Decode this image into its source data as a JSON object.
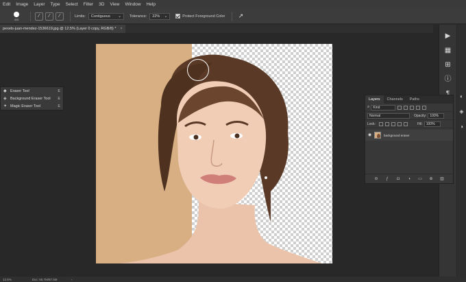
{
  "menu": {
    "items": [
      "Edit",
      "Image",
      "Layer",
      "Type",
      "Select",
      "Filter",
      "3D",
      "View",
      "Window",
      "Help"
    ]
  },
  "options": {
    "brush_size": "400",
    "limits_label": "Limits:",
    "limits_value": "Contiguous",
    "tolerance_label": "Tolerance:",
    "tolerance_value": "22%",
    "protect_label": "Protect Foreground Color"
  },
  "document": {
    "tab_title": "pexels-juan-mendez-1536619.jpg @ 12.5% (Layer 0 copy, RGB/8) *",
    "tab_close": "×"
  },
  "tool_flyout": {
    "items": [
      {
        "label": "Eraser Tool",
        "shortcut": "E",
        "icon": "eraser-icon"
      },
      {
        "label": "Background Eraser Tool",
        "shortcut": "E",
        "icon": "background-eraser-icon"
      },
      {
        "label": "Magic Eraser Tool",
        "shortcut": "E",
        "icon": "magic-eraser-icon"
      }
    ]
  },
  "layers_panel": {
    "tabs": [
      "Layers",
      "Channels",
      "Paths"
    ],
    "kind_label": "Kind",
    "blend_mode": "Normal",
    "opacity_label": "Opacity:",
    "opacity_value": "100%",
    "lock_label": "Lock:",
    "fill_label": "Fill:",
    "fill_value": "100%",
    "layer_name": "background eraser"
  },
  "status": {
    "zoom": "12.5%",
    "doc_info": "Doc: 65.7M/87.5M"
  },
  "colors": {
    "accent_background": "#d8ae83",
    "ui_dark": "#282828"
  }
}
